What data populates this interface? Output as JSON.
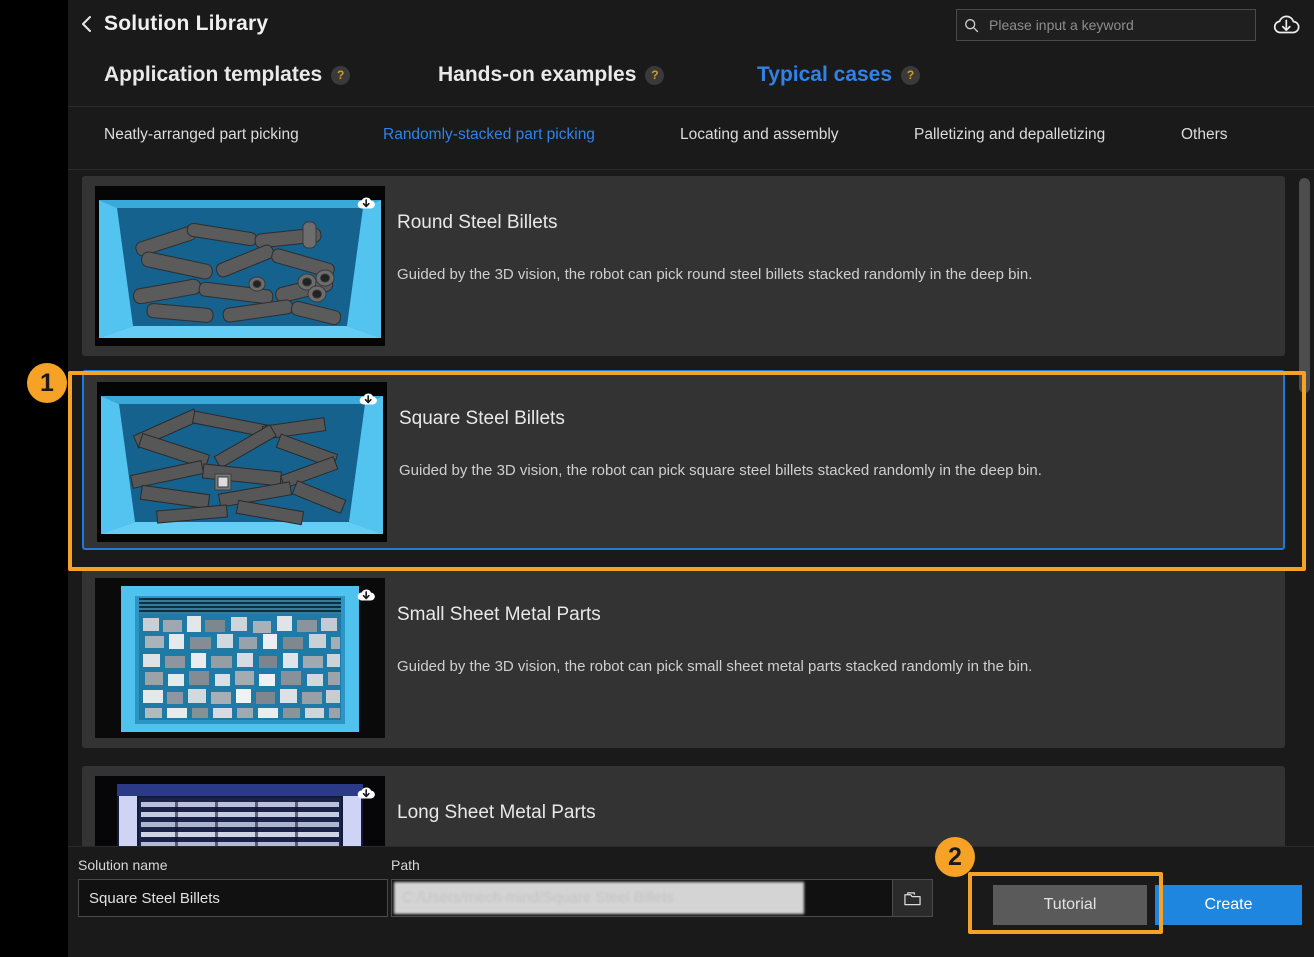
{
  "header": {
    "back_icon": "chevron-left-icon",
    "title": "Solution Library",
    "search": {
      "icon": "search-icon",
      "placeholder": "Please input a keyword",
      "value": ""
    },
    "cloud_download_icon": "cloud-download-icon"
  },
  "main_tabs": [
    {
      "label": "Application templates",
      "active": false,
      "help": "?"
    },
    {
      "label": "Hands-on examples",
      "active": false,
      "help": "?"
    },
    {
      "label": "Typical cases",
      "active": true,
      "help": "?"
    }
  ],
  "sub_tabs": [
    {
      "label": "Neatly-arranged part picking",
      "active": false
    },
    {
      "label": "Randomly-stacked part picking",
      "active": true
    },
    {
      "label": "Locating and assembly",
      "active": false
    },
    {
      "label": "Palletizing and depalletizing",
      "active": false
    },
    {
      "label": "Others",
      "active": false
    }
  ],
  "cards": [
    {
      "title": "Round Steel Billets",
      "description": "Guided by the 3D vision, the robot can pick round steel billets stacked randomly in the deep bin.",
      "selected": false,
      "download_icon": "cloud-download-icon",
      "thumb": "deep-bin-round-billets"
    },
    {
      "title": "Square Steel Billets",
      "description": "Guided by the 3D vision, the robot can pick square steel billets stacked randomly in the deep bin.",
      "selected": true,
      "download_icon": "cloud-download-icon",
      "thumb": "deep-bin-square-billets"
    },
    {
      "title": "Small Sheet Metal Parts",
      "description": "Guided by the 3D vision, the robot can pick small sheet metal parts stacked randomly in the bin.",
      "selected": false,
      "download_icon": "cloud-download-icon",
      "thumb": "shallow-bin-small-sheet-metal"
    },
    {
      "title": "Long Sheet Metal Parts",
      "description": "",
      "selected": false,
      "download_icon": "cloud-download-icon",
      "thumb": "rack-long-sheet-metal"
    }
  ],
  "bottom": {
    "solution_name_label": "Solution name",
    "solution_name_value": "Square Steel Billets",
    "path_label": "Path",
    "path_value": "C:/Users/mech-mind/Square Steel Billets",
    "folder_icon": "folder-icon",
    "tutorial_label": "Tutorial",
    "create_label": "Create"
  },
  "annotations": [
    {
      "number": "1"
    },
    {
      "number": "2"
    }
  ],
  "colors": {
    "accent_blue": "#2f83e8",
    "annotation_orange": "#f5a227",
    "create_button": "#1f86e0",
    "help_badge_text": "#d39a2a"
  }
}
